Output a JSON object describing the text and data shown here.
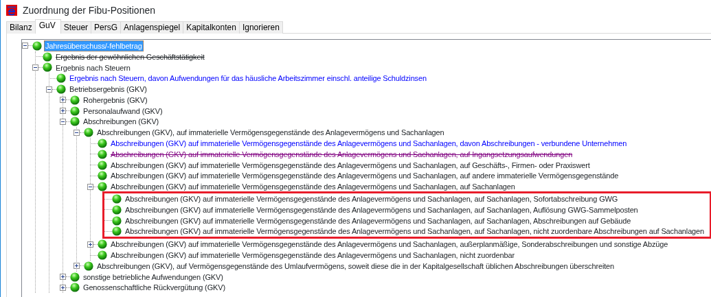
{
  "window": {
    "title": "Zuordnung der Fibu-Positionen"
  },
  "tabs": [
    {
      "label": "Bilanz",
      "selected": false
    },
    {
      "label": "GuV",
      "selected": true
    },
    {
      "label": "Steuer",
      "selected": false
    },
    {
      "label": "PersG",
      "selected": false
    },
    {
      "label": "Anlagenspiegel",
      "selected": false
    },
    {
      "label": "Kapitalkonten",
      "selected": false
    },
    {
      "label": "Ignorieren",
      "selected": false
    }
  ],
  "tree": [
    {
      "label": "Jahresüberschuss/-fehlbetrag",
      "expanded": true,
      "selected": true,
      "struck": false,
      "children": [
        {
          "label": "Ergebnis der gewöhnlichen Geschäftstätigkeit",
          "selected": false,
          "struck": true
        },
        {
          "label": "Ergebnis nach Steuern",
          "expanded": true,
          "selected": false,
          "struck": false,
          "children": [
            {
              "label": "Ergebnis nach Steuern, davon Aufwendungen für das häusliche Arbeitszimmer einschl. anteilige Schuldzinsen",
              "selected": false,
              "struck": false,
              "color": "#0000ff"
            },
            {
              "label": "Betriebsergebnis (GKV)",
              "expanded": true,
              "selected": false,
              "struck": false,
              "children": [
                {
                  "label": "Rohergebnis (GKV)",
                  "expanded": false,
                  "selected": false,
                  "struck": false
                },
                {
                  "label": "Personalaufwand (GKV)",
                  "expanded": false,
                  "selected": false,
                  "struck": false
                },
                {
                  "label": "Abschreibungen (GKV)",
                  "expanded": true,
                  "selected": false,
                  "struck": false,
                  "children": [
                    {
                      "label": "Abschreibungen (GKV), auf immaterielle Vermögensgegenstände des Anlagevermögens und Sachanlagen",
                      "expanded": true,
                      "selected": false,
                      "struck": false,
                      "children": [
                        {
                          "label": "Abschreibungen (GKV) auf immaterielle Vermögensgegenstände des Anlagevermögens und Sachanlagen, davon Abschreibungen - verbundene Unternehmen",
                          "selected": false,
                          "struck": false,
                          "color": "#0000ff"
                        },
                        {
                          "label": "Abschreibungen (GKV) auf immaterielle Vermögensgegenstände des Anlagevermögens und Sachanlagen, auf Ingangsetzungsaufwendungen",
                          "selected": false,
                          "struck": true,
                          "color": "#800080"
                        },
                        {
                          "label": "Abschreibungen (GKV) auf immaterielle Vermögensgegenstände des Anlagevermögens und Sachanlagen, auf Geschäfts-, Firmen- oder Praxiswert",
                          "selected": false,
                          "struck": false
                        },
                        {
                          "label": "Abschreibungen (GKV) auf immaterielle Vermögensgegenstände des Anlagevermögens und Sachanlagen, auf andere immaterielle Vermögensgegenstände",
                          "selected": false,
                          "struck": false
                        },
                        {
                          "label": "Abschreibungen (GKV) auf immaterielle Vermögensgegenstände des Anlagevermögens und Sachanlagen, auf Sachanlagen",
                          "expanded": true,
                          "selected": false,
                          "struck": false,
                          "outlined": true,
                          "children": [
                            {
                              "label": "Abschreibungen (GKV) auf immaterielle Vermögensgegenstände des Anlagevermögens und Sachanlagen, auf Sachanlagen, Sofortabschreibung GWG",
                              "selected": false,
                              "struck": false
                            },
                            {
                              "label": "Abschreibungen (GKV) auf immaterielle Vermögensgegenstände des Anlagevermögens und Sachanlagen, auf Sachanlagen, Auflösung GWG-Sammelposten",
                              "selected": false,
                              "struck": false
                            },
                            {
                              "label": "Abschreibungen (GKV) auf immaterielle Vermögensgegenstände des Anlagevermögens und Sachanlagen, auf Sachanlagen, Abschreibungen auf Gebäude",
                              "selected": false,
                              "struck": false
                            },
                            {
                              "label": "Abschreibungen (GKV) auf immaterielle Vermögensgegenstände des Anlagevermögens und Sachanlagen, auf Sachanlagen, nicht zuordenbare Abschreibungen auf Sachanlagen",
                              "selected": false,
                              "struck": false
                            }
                          ]
                        },
                        {
                          "label": "Abschreibungen (GKV) auf immaterielle Vermögensgegenstände des Anlagevermögens und Sachanlagen, außerplanmäßige, Sonderabschreibungen und sonstige Abzüge",
                          "expanded": false,
                          "selected": false,
                          "struck": false
                        },
                        {
                          "label": "Abschreibungen (GKV) auf immaterielle Vermögensgegenstände des Anlagevermögens und Sachanlagen, nicht zuordenbar",
                          "selected": false,
                          "struck": false
                        }
                      ]
                    },
                    {
                      "label": "Abschreibungen (GKV), auf Vermögensgegenstände des Umlaufvermögens, soweit diese die in der Kapitalgesellschaft üblichen Abschreibungen überschreiten",
                      "expanded": false,
                      "selected": false,
                      "struck": false
                    }
                  ]
                },
                {
                  "label": "sonstige betriebliche Aufwendungen (GKV)",
                  "expanded": false,
                  "selected": false,
                  "struck": false
                },
                {
                  "label": "Genossenschaftliche Rückvergütung (GKV)",
                  "expanded": false,
                  "selected": false,
                  "struck": false
                }
              ]
            }
          ]
        }
      ]
    }
  ]
}
